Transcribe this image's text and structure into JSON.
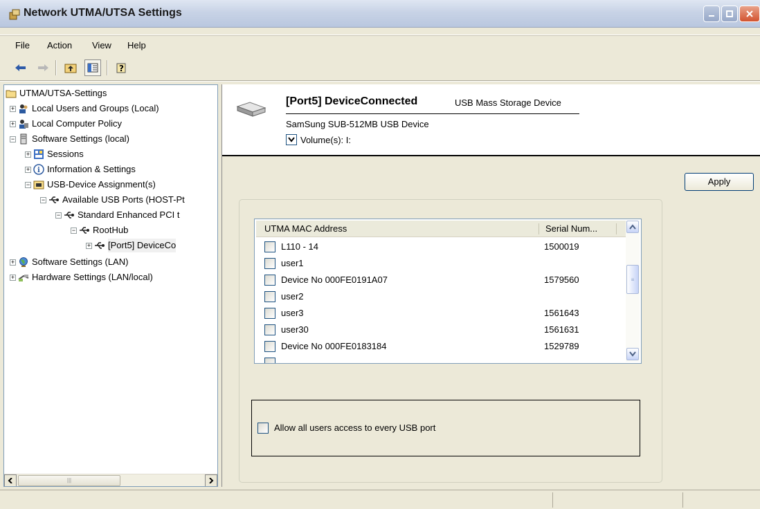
{
  "window": {
    "title": "Network UTMA/UTSA Settings",
    "controls": [
      "minimize",
      "maximize",
      "close"
    ]
  },
  "menu": {
    "items": [
      {
        "label": "File"
      },
      {
        "label": "Action"
      },
      {
        "label": "View"
      },
      {
        "label": "Help"
      }
    ]
  },
  "toolbar": {
    "buttons": [
      "back-arrow-icon",
      "forward-arrow-icon",
      "up-folder-icon",
      "show-hide-tree-icon",
      "help-icon"
    ]
  },
  "tree": {
    "root": "UTMA/UTSA-Settings",
    "nodes": [
      {
        "label": "Local Users and Groups (Local)"
      },
      {
        "label": "Local Computer Policy"
      },
      {
        "label": "Software Settings (local)"
      },
      {
        "label": "Sessions"
      },
      {
        "label": "Information & Settings"
      },
      {
        "label": "USB-Device Assignment(s)"
      },
      {
        "label": "Available USB Ports (HOST-Pt"
      },
      {
        "label": "Standard Enhanced PCI t"
      },
      {
        "label": "RootHub"
      },
      {
        "label": "[Port5] DeviceCo"
      },
      {
        "label": "Software Settings (LAN)"
      },
      {
        "label": "Hardware Settings (LAN/local)"
      }
    ]
  },
  "device": {
    "title": "[Port5] DeviceConnected",
    "type": "USB Mass Storage Device",
    "name": "SamSung  SUB-512MB USB Device",
    "volumes_label": "Volume(s):  I:"
  },
  "buttons": {
    "apply": "Apply"
  },
  "list": {
    "columns": [
      "UTMA MAC Address",
      "Serial Num..."
    ],
    "rows": [
      {
        "name": "L110 - 14",
        "serial": "1500019"
      },
      {
        "name": "user1",
        "serial": ""
      },
      {
        "name": "Device No  000FE0191A07",
        "serial": "1579560"
      },
      {
        "name": "user2",
        "serial": ""
      },
      {
        "name": "user3",
        "serial": "1561643"
      },
      {
        "name": "user30",
        "serial": "1561631"
      },
      {
        "name": "Device No  000FE0183184",
        "serial": "1529789"
      }
    ]
  },
  "allow_all": {
    "label": "Allow all users access to every USB port",
    "checked": false
  }
}
